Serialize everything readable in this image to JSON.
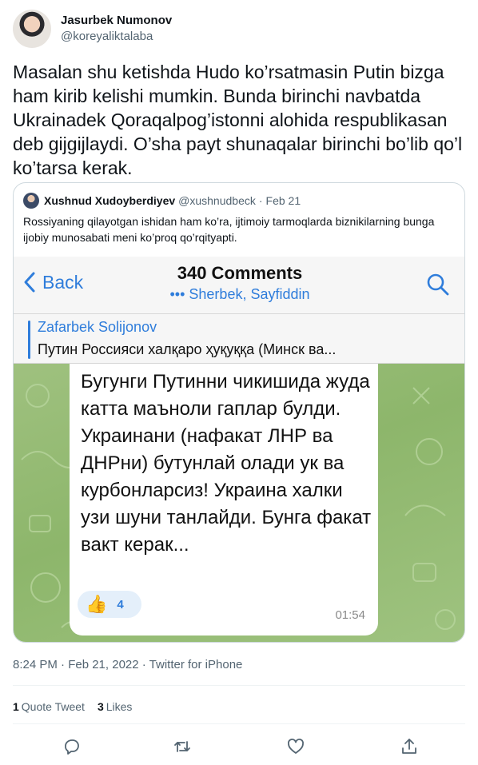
{
  "author": {
    "display_name": "Jasurbek Numonov",
    "handle": "@koreyaliktalaba"
  },
  "tweet_text": "Masalan shu ketishda Hudo ko’rsatmasin Putin bizga ham kirib kelishi mumkin. Bunda birinchi navbatda Ukrainadek Qoraqalpog’istonni alohida respublikasan deb gijgijlaydi. O’sha payt shunaqalar birinchi bo’lib qo’l ko’tarsa kerak.",
  "quote": {
    "display_name": "Xushnud Xudoyberdiyev",
    "handle": "@xushnudbeck",
    "dot": "·",
    "date": "Feb 21",
    "text": "Rossiyaning qilayotgan ishidan ham ko’ra, ijtimoiy tarmoqlarda biznikilarning bunga ijobiy munosabati meni ko’proq qo’rqityapti.",
    "media": {
      "back_label": "Back",
      "title": "340 Comments",
      "subtitle": "••• Sherbek, Sayfiddin",
      "reply_name": "Zafarbek Solijonov",
      "reply_text": "Путин Россияси халқаро ҳуқуққа (Минск ва...",
      "message_text": "Бугунги Путинни чикишида жуда катта маъноли гаплар булди. Украинани (нафакат ЛНР ва ДНРни) бутунлай олади ук ва курбонларсиз! Украина халки узи шуни танлайди. Бунга факат вакт керак...",
      "reaction_emoji": "👍",
      "reaction_count": "4",
      "message_time": "01:54",
      "accent_color": "#2f7ddb",
      "chat_bg_color": "#9abf7a"
    }
  },
  "meta": "8:24 PM · Feb 21, 2022 · Twitter for iPhone",
  "stats": {
    "quote_tweets_count": "1",
    "quote_tweets_label": "Quote Tweet",
    "likes_count": "3",
    "likes_label": "Likes"
  },
  "actions": [
    "reply-icon",
    "retweet-icon",
    "like-icon",
    "share-icon"
  ]
}
